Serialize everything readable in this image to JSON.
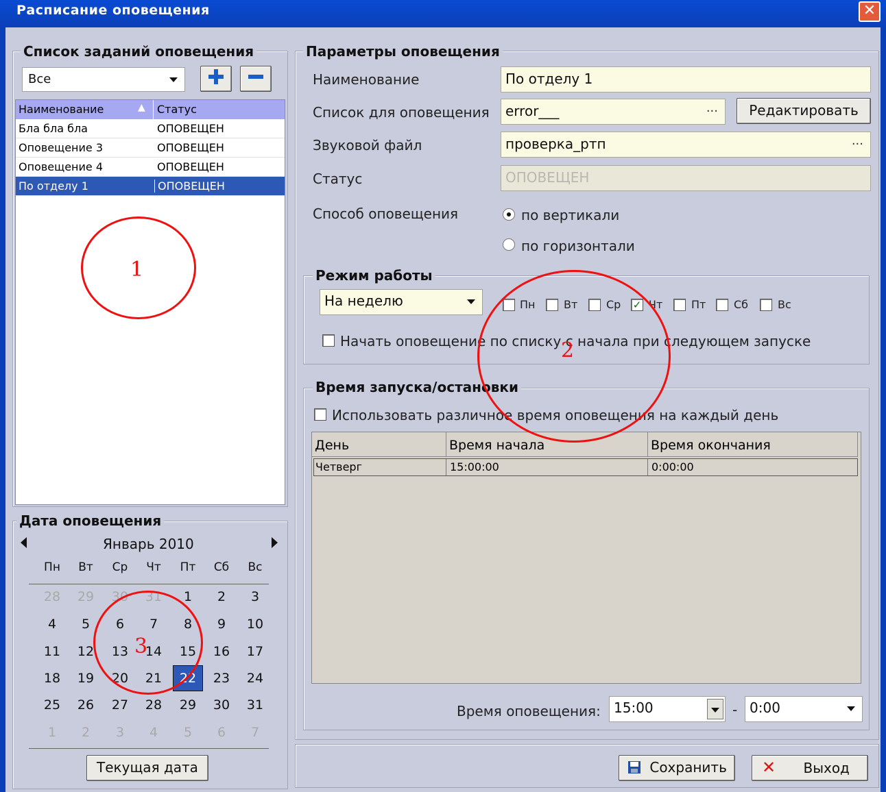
{
  "window": {
    "title": "Расписание оповещения",
    "close_symbol": "✕"
  },
  "tasks": {
    "title": "Список заданий оповещения",
    "filter": "Все",
    "add_label": "+",
    "remove_label": "−",
    "columns": [
      "Наименование",
      "Статус"
    ],
    "rows": [
      {
        "name": "Бла бла бла",
        "status": "ОПОВЕЩЕН"
      },
      {
        "name": "Оповещение 3",
        "status": "ОПОВЕЩЕН"
      },
      {
        "name": "Оповещение 4",
        "status": "ОПОВЕЩЕН"
      },
      {
        "name": "По отделу 1",
        "status": "ОПОВЕЩЕН"
      }
    ],
    "annotation": "1"
  },
  "params": {
    "title": "Параметры оповещения",
    "name_label": "Наименование",
    "name_value": "По отделу 1",
    "list_label": "Список для оповещения",
    "list_value": "error___",
    "list_dots": "...",
    "edit_button": "Редактировать",
    "sound_label": "Звуковой файл",
    "sound_value": "проверка_ртп",
    "sound_dots": "...",
    "status_label": "Статус",
    "status_value": "ОПОВЕЩЕН",
    "method_label": "Способ оповещения",
    "method_vertical": "по вертикали",
    "method_horizontal": "по горизонтали"
  },
  "mode": {
    "title": "Режим работы",
    "period": "На неделю",
    "days": [
      "Пн",
      "Вт",
      "Ср",
      "Чт",
      "Пт",
      "Сб",
      "Вс"
    ],
    "checked_day": "Чт",
    "restart_label": "Начать оповещение по списку с начала при следующем запуске",
    "annotation": "2"
  },
  "time": {
    "title": "Время запуска/остановки",
    "per_day_label": "Использовать различное время оповещения на каждый день",
    "columns": [
      "День",
      "Время начала",
      "Время окончания"
    ],
    "rows": [
      {
        "day": "Четверг",
        "start": "15:00:00",
        "end": "0:00:00"
      }
    ],
    "notify_label": "Время оповещения:",
    "start_value": "15:00",
    "dash": "-",
    "end_value": "0:00"
  },
  "calendar": {
    "title": "Дата оповещения",
    "month": "Январь 2010",
    "weekdays": [
      "Пн",
      "Вт",
      "Ср",
      "Чт",
      "Пт",
      "Сб",
      "Вс"
    ],
    "weeks": [
      [
        "28",
        "29",
        "30",
        "31",
        "1",
        "2",
        "3"
      ],
      [
        "4",
        "5",
        "6",
        "7",
        "8",
        "9",
        "10"
      ],
      [
        "11",
        "12",
        "13",
        "14",
        "15",
        "16",
        "17"
      ],
      [
        "18",
        "19",
        "20",
        "21",
        "22",
        "23",
        "24"
      ],
      [
        "25",
        "26",
        "27",
        "28",
        "29",
        "30",
        "31"
      ],
      [
        "1",
        "2",
        "3",
        "4",
        "5",
        "6",
        "7"
      ]
    ],
    "today_button": "Текущая дата",
    "annotation": "3"
  },
  "footer": {
    "save_button": "Сохранить",
    "exit_button": "Выход"
  }
}
